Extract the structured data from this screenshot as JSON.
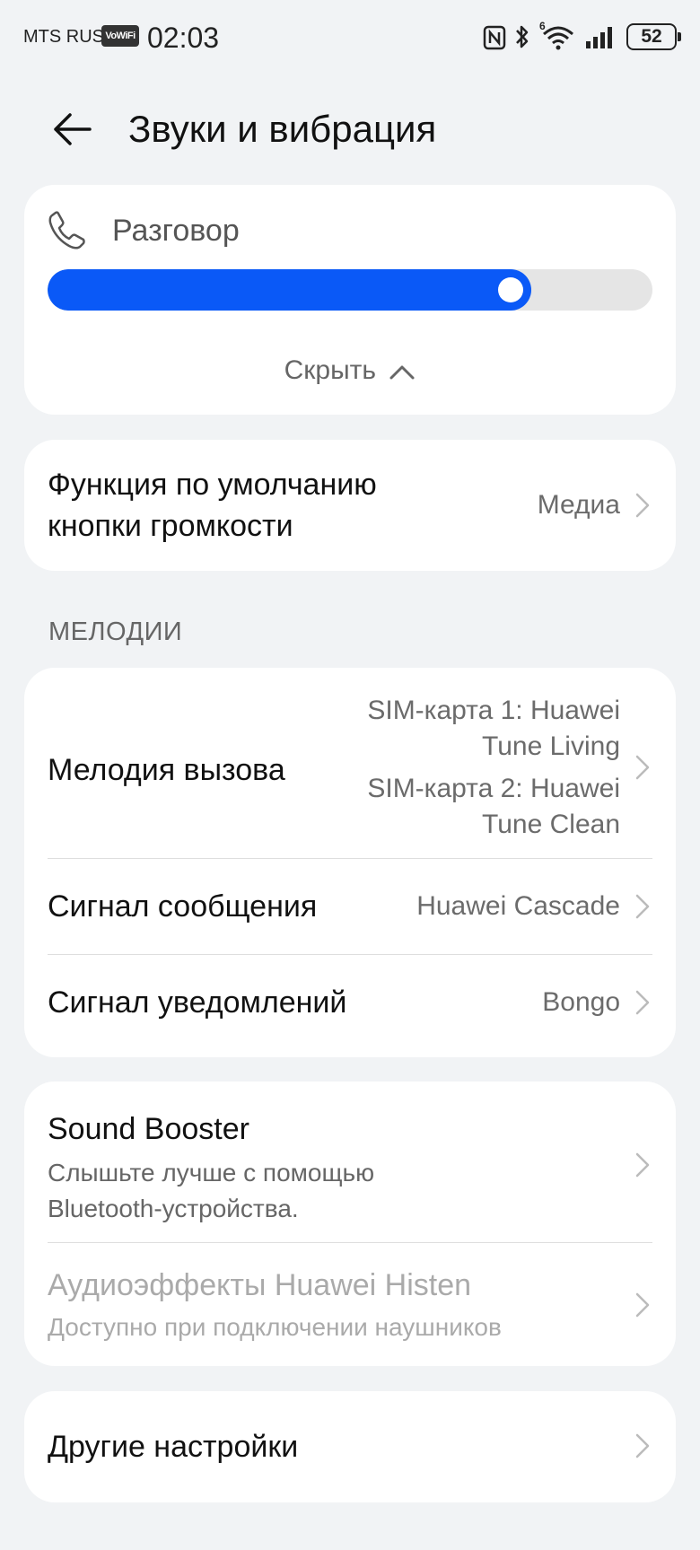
{
  "status_bar": {
    "carrier": "MTS RUS",
    "vowifi": "VoWiFi",
    "time": "02:03",
    "battery": "52",
    "wifi_label": "6"
  },
  "header": {
    "title": "Звуки и вибрация"
  },
  "volume": {
    "label": "Разговор",
    "level_percent": 80,
    "hide_label": "Скрыть",
    "accent_color": "#0a59f7"
  },
  "volume_key": {
    "title_line1": "Функция по умолчанию",
    "title_line2": "кнопки громкости",
    "value": "Медиа"
  },
  "melodies": {
    "section_title": "МЕЛОДИИ",
    "ringtone": {
      "title": "Мелодия вызова",
      "sim1_line1": "SIM-карта 1: Huawei",
      "sim1_line2": "Tune Living",
      "sim2_line1": "SIM-карта 2: Huawei",
      "sim2_line2": "Tune Clean"
    },
    "message": {
      "title": "Сигнал сообщения",
      "value": "Huawei Cascade"
    },
    "notification": {
      "title": "Сигнал уведомлений",
      "value": "Bongo"
    }
  },
  "booster": {
    "title": "Sound Booster",
    "sub_line1": "Слышьте лучше с помощью",
    "sub_line2": "Bluetooth-устройства."
  },
  "histen": {
    "title": "Аудиоэффекты Huawei Histen",
    "subtitle": "Доступно при подключении наушников"
  },
  "other": {
    "title": "Другие настройки"
  }
}
